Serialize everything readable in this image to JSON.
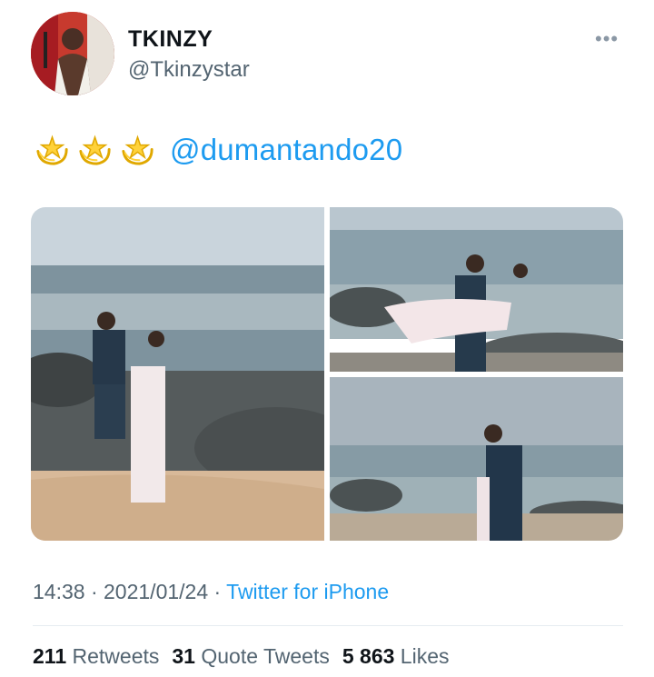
{
  "author": {
    "name": "TKINZY",
    "handle": "@Tkinzystar"
  },
  "tweet": {
    "emojis": [
      "dizzy-icon",
      "dizzy-icon",
      "dizzy-icon"
    ],
    "mention": "@dumantando20"
  },
  "meta": {
    "time": "14:38",
    "separator": " · ",
    "date": "2021/01/24",
    "source": "Twitter for iPhone"
  },
  "stats": {
    "retweets_count": "211",
    "retweets_label": " Retweets",
    "quotes_count": "31",
    "quotes_label": " Quote Tweets",
    "likes_count": "5 863",
    "likes_label": " Likes"
  },
  "colors": {
    "link": "#1d9bf0",
    "secondary_text": "#536471",
    "primary_text": "#0f1419",
    "divider": "#e6ecf0"
  }
}
